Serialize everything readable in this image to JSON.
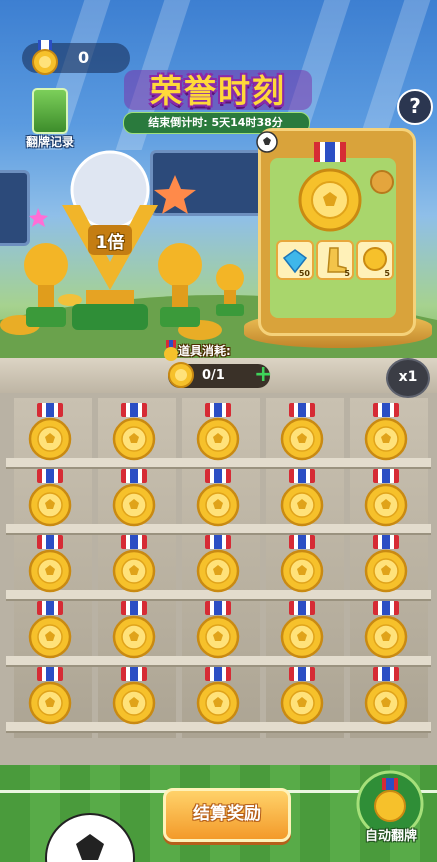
{
  "header": {
    "coin_count": "0",
    "flip_record_label": "翻牌记录",
    "help_label": "?"
  },
  "title": {
    "text": "荣誉时刻",
    "countdown": "结束倒计时: 5天14时38分"
  },
  "trophy": {
    "multiplier": "1倍"
  },
  "card_panel": {
    "items": [
      {
        "icon": "diamond-icon",
        "count": "50"
      },
      {
        "icon": "boot-icon",
        "count": "5"
      },
      {
        "icon": "coin-icon",
        "count": "5"
      }
    ]
  },
  "consume": {
    "label": "道具消耗:",
    "value": "0/1",
    "add_label": "+"
  },
  "multiplier_button": "x1",
  "grid": {
    "rows": 5,
    "cols": 5
  },
  "buttons": {
    "settle": "结算奖励",
    "auto_flip": "自动翻牌"
  },
  "colors": {
    "medal_gold": "#f6c12b",
    "ribbon_red": "#d62b35",
    "ribbon_blue": "#2b4ec4",
    "button_orange": "#f39a2a"
  }
}
